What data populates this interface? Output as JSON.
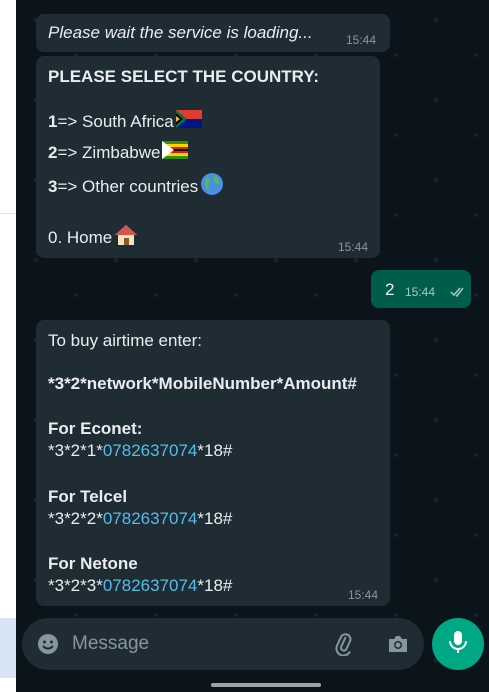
{
  "messages": {
    "loading": {
      "text": "Please wait the service is loading...",
      "time": "15:44"
    },
    "country_menu": {
      "title": "PLEASE SELECT THE COUNTRY:",
      "options": [
        {
          "key": "1",
          "label": "=> South Africa"
        },
        {
          "key": "2",
          "label": "=> Zimbabwe"
        },
        {
          "key": "3",
          "label": "=> Other countries"
        }
      ],
      "home": "0. Home",
      "time": "15:44"
    },
    "reply": {
      "text": "2",
      "time": "15:44"
    },
    "airtime": {
      "intro": "To buy airtime enter:",
      "format": "*3*2*network*MobileNumber*Amount#",
      "sections": [
        {
          "title": "For Econet:",
          "prefix": "*3*2*1*",
          "number": "0782637074",
          "suffix": "*18#"
        },
        {
          "title": "For Telcel",
          "prefix": "*3*2*2*",
          "number": "0782637074",
          "suffix": "*18#"
        },
        {
          "title": "For Netone",
          "prefix": "*3*2*3*",
          "number": "0782637074",
          "suffix": "*18#"
        }
      ],
      "time": "15:44"
    }
  },
  "composer": {
    "placeholder": "Message"
  },
  "colors": {
    "background": "#0b141a",
    "incoming_bubble": "#1f2c34",
    "outgoing_bubble": "#005c4b",
    "link": "#53bdeb",
    "accent": "#00a884"
  },
  "icons": [
    "emoji-icon",
    "attach-icon",
    "camera-icon",
    "mic-icon",
    "double-check-icon",
    "south-africa-flag-icon",
    "zimbabwe-flag-icon",
    "globe-icon",
    "house-icon"
  ]
}
